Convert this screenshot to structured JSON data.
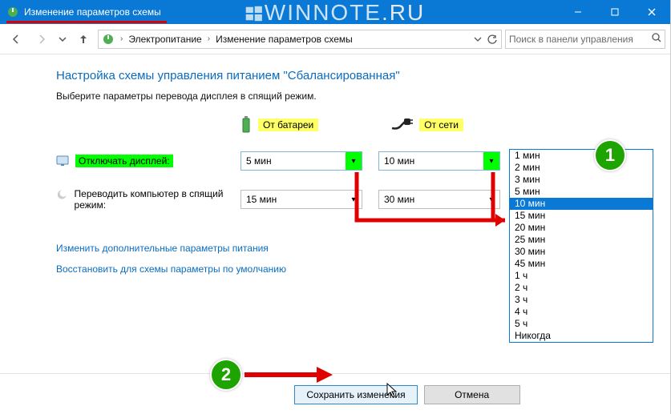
{
  "window": {
    "title": "Изменение параметров схемы"
  },
  "watermark": {
    "a": "WINNOTE",
    "b": ".RU"
  },
  "path": {
    "root": "Электропитание",
    "leaf": "Изменение параметров схемы"
  },
  "search": {
    "placeholder": "Поиск в панели управления"
  },
  "page": {
    "heading": "Настройка схемы управления питанием \"Сбалансированная\"",
    "subtext": "Выберите параметры перевода дисплея в спящий режим."
  },
  "columns": {
    "battery": "От батареи",
    "ac": "От сети"
  },
  "rows": {
    "display_off": {
      "label": "Отключать дисплей:",
      "battery": "5 мин",
      "ac": "10 мин"
    },
    "sleep": {
      "label": "Переводить компьютер в спящий режим:",
      "battery": "15 мин",
      "ac": "30 мин"
    }
  },
  "links": {
    "advanced": "Изменить дополнительные параметры питания",
    "restore": "Восстановить для схемы параметры по умолчанию"
  },
  "buttons": {
    "save": "Сохранить изменения",
    "cancel": "Отмена"
  },
  "dropdown_options": [
    "1 мин",
    "2 мин",
    "3 мин",
    "5 мин",
    "10 мин",
    "15 мин",
    "20 мин",
    "25 мин",
    "30 мин",
    "45 мин",
    "1 ч",
    "2 ч",
    "3 ч",
    "4 ч",
    "5 ч",
    "Никогда"
  ],
  "dropdown_selected": "10 мин",
  "badges": {
    "one": "1",
    "two": "2"
  }
}
